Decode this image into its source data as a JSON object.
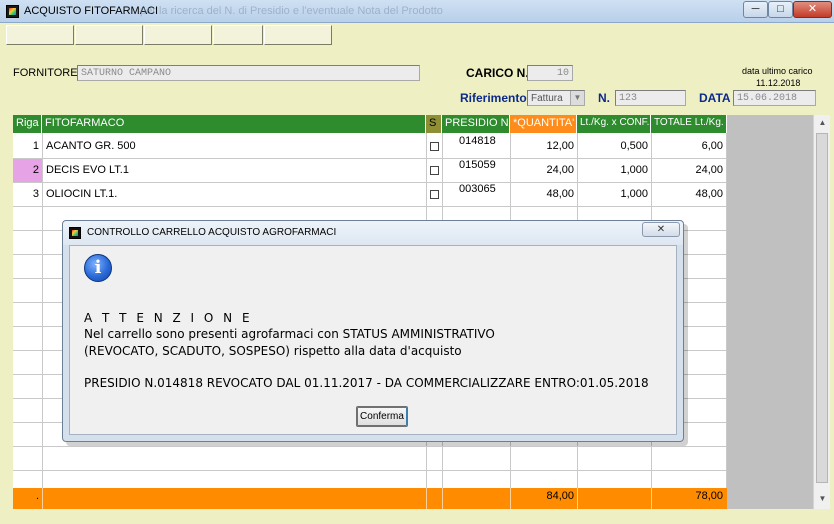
{
  "window": {
    "title": "ACQUISTO FITOFARMACI",
    "ghost_title": "per la ricerca del N. di Presidio e l'eventuale Nota del Prodotto",
    "min": "─",
    "max": "□",
    "close": "✕"
  },
  "toolbar": {
    "buttons": [
      "",
      "",
      "",
      "",
      ""
    ]
  },
  "header": {
    "fornitore_label": "FORNITORE",
    "fornitore_value": "SATURNO CAMPANO",
    "carico_label": "CARICO N.",
    "carico_value": "10",
    "ultimo_label": "data ultimo carico",
    "ultimo_value": "11.12.2018",
    "riferimento_label": "Riferimento",
    "riferimento_value": "Fattura",
    "n_label": "N.",
    "n_value": "123",
    "data_label": "DATA",
    "data_value": "15.06.2018"
  },
  "table": {
    "columns": [
      "Riga",
      "FITOFARMACO",
      "S",
      "PRESIDIO N.",
      "*QUANTITA'",
      "Lt./Kg. x CONF.",
      "TOTALE Lt./Kg."
    ],
    "rows": [
      {
        "riga": "1",
        "fitofarmaco": "ACANTO GR. 500",
        "presidio": "014818",
        "quantita": "12,00",
        "conf": "0,500",
        "totale": "6,00"
      },
      {
        "riga": "2",
        "fitofarmaco": "DECIS EVO LT.1",
        "presidio": "015059",
        "quantita": "24,00",
        "conf": "1,000",
        "totale": "24,00"
      },
      {
        "riga": "3",
        "fitofarmaco": "OLIOCIN LT.1.",
        "presidio": "003065",
        "quantita": "48,00",
        "conf": "1,000",
        "totale": "48,00"
      }
    ],
    "totals": {
      "riga": ".",
      "quantita": "84,00",
      "totale": "78,00"
    }
  },
  "dialog": {
    "title": "CONTROLLO CARRELLO ACQUISTO AGROFARMACI",
    "close": "✕",
    "info_glyph": "i",
    "line1": "A T T E N Z I O N E",
    "line2": "Nel carrello sono presenti agrofarmaci con STATUS AMMINISTRATIVO",
    "line3": "(REVOCATO, SCADUTO, SOSPESO) rispetto alla data d'acquisto",
    "line4": "PRESIDIO N.014818 REVOCATO DAL 01.11.2017 - DA COMMERCIALIZZARE ENTRO:01.05.2018",
    "button": "Conferma"
  },
  "colors": {
    "accent_green": "#2e8b2e",
    "accent_orange": "#ff8c1a",
    "selected_row": "#e6a3e6",
    "form_bg": "#efefc4"
  },
  "icons": [
    "app-icon",
    "info-icon",
    "checkbox-icon",
    "scroll-up-icon",
    "scroll-down-icon"
  ]
}
